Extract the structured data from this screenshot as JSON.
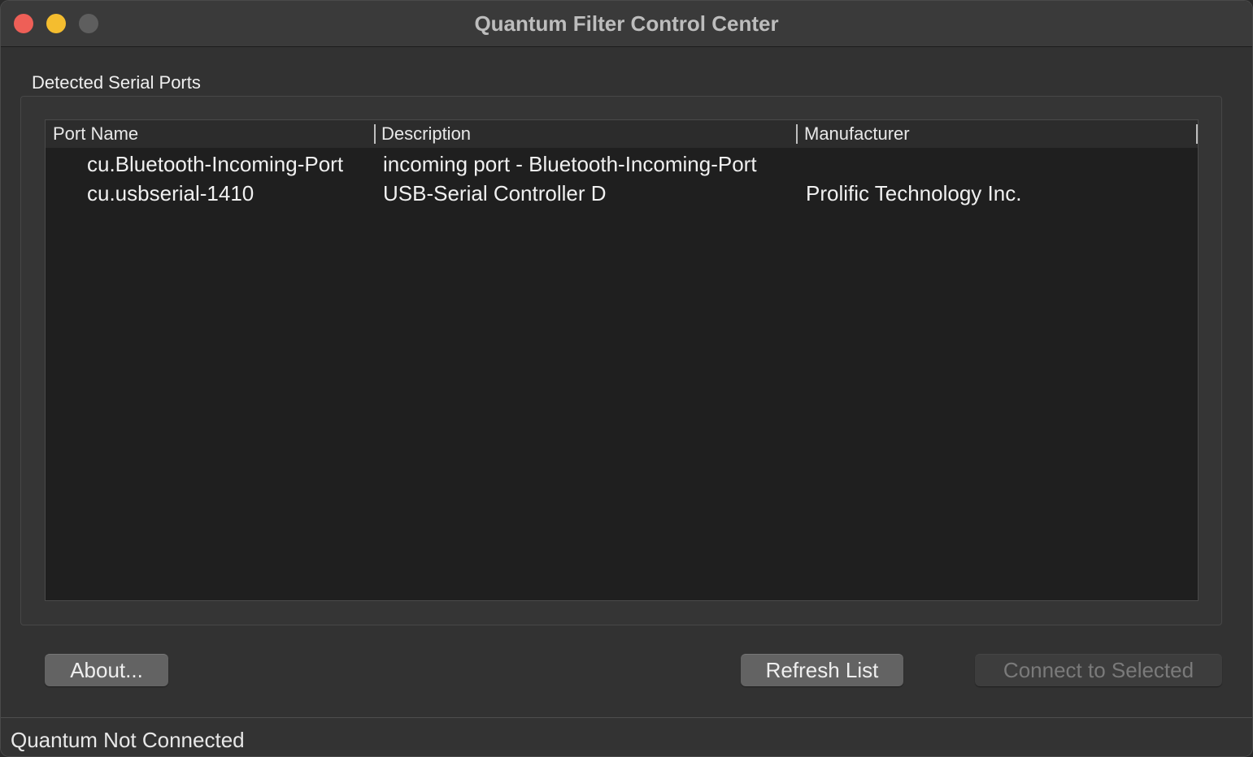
{
  "window": {
    "title": "Quantum Filter Control Center"
  },
  "ports_group": {
    "label": "Detected Serial Ports",
    "columns": [
      "Port Name",
      "Description",
      "Manufacturer"
    ],
    "rows": [
      {
        "port_name": "cu.Bluetooth-Incoming-Port",
        "description": "incoming port - Bluetooth-Incoming-Port",
        "manufacturer": ""
      },
      {
        "port_name": "cu.usbserial-1410",
        "description": "USB-Serial Controller D",
        "manufacturer": "Prolific Technology Inc."
      }
    ]
  },
  "buttons": {
    "about": "About...",
    "refresh": "Refresh List",
    "connect": "Connect to Selected"
  },
  "status": {
    "text": "Quantum Not Connected"
  },
  "colors": {
    "close": "#ee5f57",
    "minimize": "#f4bd2f",
    "zoom_disabled": "#5e5e5e"
  }
}
